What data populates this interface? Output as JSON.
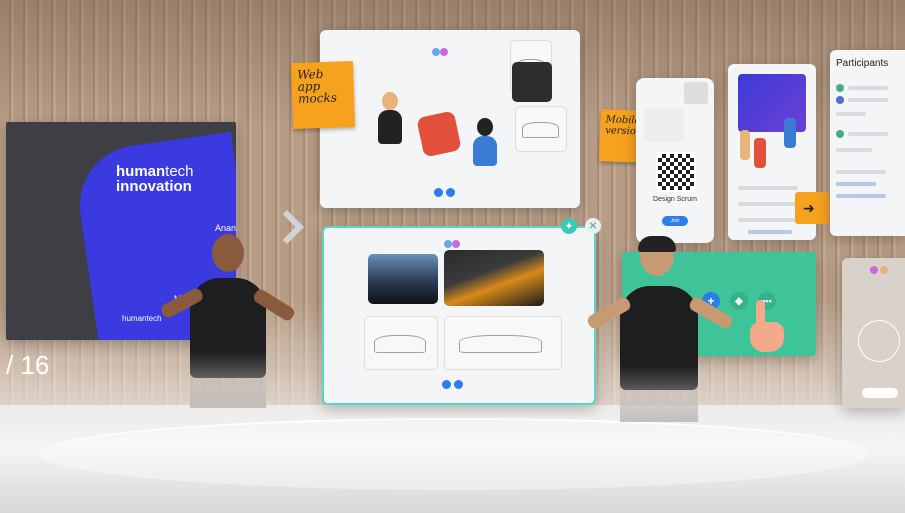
{
  "scene": {
    "slide": {
      "brand_line1": "human",
      "brand_line1_light": "tech",
      "brand_line2": "innovation",
      "presenter": "Anand",
      "date": "May",
      "company": "humantech"
    },
    "slide_counter": "/ 16",
    "sticky_web": "Web app mocks",
    "sticky_mobile": "Mobile version",
    "mobile_panel": {
      "title": "Design Scrum",
      "join_label": "Join"
    },
    "participants_panel": {
      "title": "Participants"
    },
    "colors": {
      "accent": "#58d6c6",
      "sticky": "#f7a21f",
      "slide_blue": "#3a3ae0",
      "green_panel": "#3ec498",
      "button_blue": "#2b7de9"
    },
    "icons": [
      "chevron-right-icon",
      "pin-icon",
      "close-icon",
      "plus-icon",
      "layers-icon",
      "more-icon",
      "hand-pointer-icon",
      "arrow-icon"
    ]
  }
}
